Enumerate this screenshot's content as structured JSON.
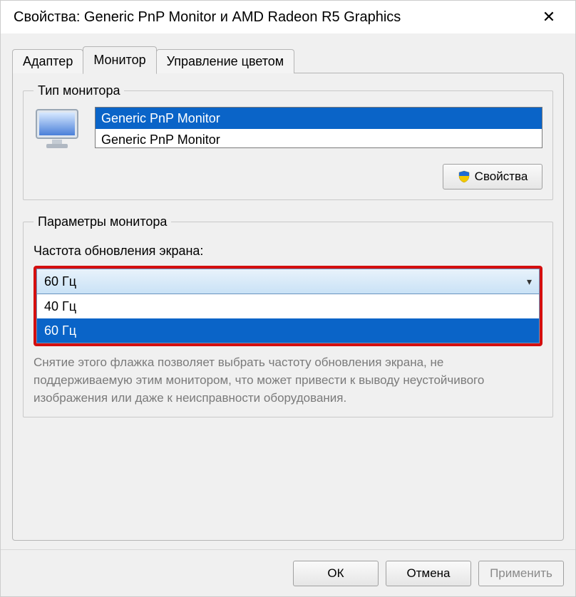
{
  "window": {
    "title": "Свойства: Generic PnP Monitor и AMD Radeon R5 Graphics"
  },
  "tabs": {
    "adapter": "Адаптер",
    "monitor": "Монитор",
    "color_mgmt": "Управление цветом"
  },
  "monitor_type": {
    "legend": "Тип монитора",
    "items": [
      "Generic PnP Monitor",
      "Generic PnP Monitor"
    ],
    "selected_index": 0,
    "properties_button": "Свойства"
  },
  "monitor_params": {
    "legend": "Параметры монитора",
    "refresh_label": "Частота обновления экрана:",
    "selected": "60 Гц",
    "options": [
      "40 Гц",
      "60 Гц"
    ],
    "highlighted_index": 1,
    "hint": "Снятие этого флажка позволяет выбрать частоту обновления экрана, не поддерживаемую этим монитором, что может привести к выводу неустойчивого изображения или даже к неисправности оборудования."
  },
  "footer": {
    "ok": "ОК",
    "cancel": "Отмена",
    "apply": "Применить"
  }
}
